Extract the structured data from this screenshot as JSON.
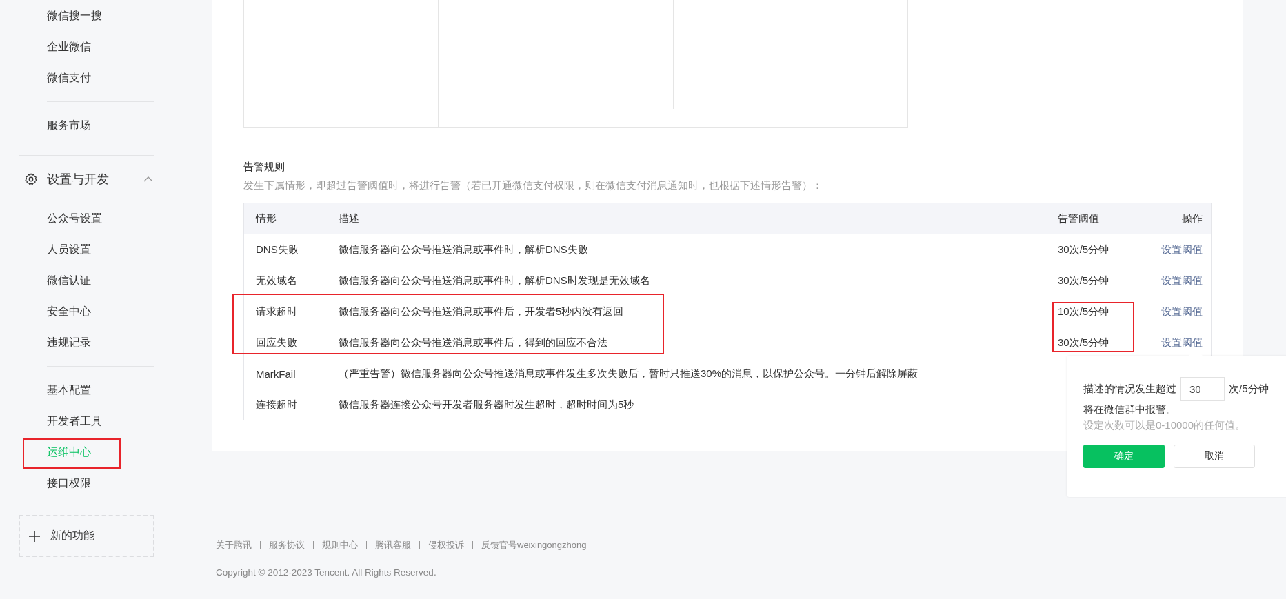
{
  "sidebar": {
    "groups": [
      {
        "items": [
          {
            "label": "微信搜一搜",
            "selected": false
          },
          {
            "label": "企业微信",
            "selected": false
          },
          {
            "label": "微信支付",
            "selected": false
          }
        ]
      },
      {
        "items": [
          {
            "label": "服务市场",
            "selected": false
          }
        ]
      },
      {
        "section": {
          "label": "设置与开发",
          "expanded": true
        },
        "items": [
          {
            "label": "公众号设置",
            "selected": false
          },
          {
            "label": "人员设置",
            "selected": false
          },
          {
            "label": "微信认证",
            "selected": false
          },
          {
            "label": "安全中心",
            "selected": false
          },
          {
            "label": "违规记录",
            "selected": false
          }
        ]
      },
      {
        "items": [
          {
            "label": "基本配置",
            "selected": false
          },
          {
            "label": "开发者工具",
            "selected": false
          },
          {
            "label": "运维中心",
            "selected": true
          },
          {
            "label": "接口权限",
            "selected": false
          }
        ]
      }
    ],
    "new_feature_button": "新的功能"
  },
  "alert_rules": {
    "title": "告警规则",
    "subtitle": "发生下属情形，即超过告警阈值时，将进行告警（若已开通微信支付权限，则在微信支付消息通知时，也根据下述情形告警）：",
    "columns": [
      "情形",
      "描述",
      "告警阈值",
      "操作"
    ],
    "rows": [
      {
        "case": "DNS失败",
        "description": "微信服务器向公众号推送消息或事件时，解析DNS失败",
        "threshold": "30次/5分钟",
        "action": "设置阈值"
      },
      {
        "case": "无效域名",
        "description": "微信服务器向公众号推送消息或事件时，解析DNS时发现是无效域名",
        "threshold": "30次/5分钟",
        "action": "设置阈值"
      },
      {
        "case": "请求超时",
        "description": "微信服务器向公众号推送消息或事件后，开发者5秒内没有返回",
        "threshold": "10次/5分钟",
        "action": "设置阈值"
      },
      {
        "case": "回应失败",
        "description": "微信服务器向公众号推送消息或事件后，得到的回应不合法",
        "threshold": "30次/5分钟",
        "action": "设置阈值"
      },
      {
        "case": "MarkFail",
        "description": "（严重告警）微信服务器向公众号推送消息或事件发生多次失败后，暂时只推送30%的消息，以保护公众号。一分钟后解除屏蔽"
      },
      {
        "case": "连接超时",
        "description": "微信服务器连接公众号开发者服务器时发生超时，超时时间为5秒"
      }
    ]
  },
  "threshold_popover": {
    "label": "描述的情况发生超过",
    "value": "30",
    "unit": "次/5分钟",
    "note": "将在微信群中报警。",
    "hint": "设定次数可以是0-10000的任何值。",
    "confirm": "确定",
    "cancel": "取消"
  },
  "footer": {
    "links": [
      "关于腾讯",
      "服务协议",
      "规则中心",
      "腾讯客服",
      "侵权投诉",
      "反馈官号weixingongzhong"
    ],
    "copyright": "Copyright © 2012-2023 Tencent. All Rights Reserved."
  }
}
